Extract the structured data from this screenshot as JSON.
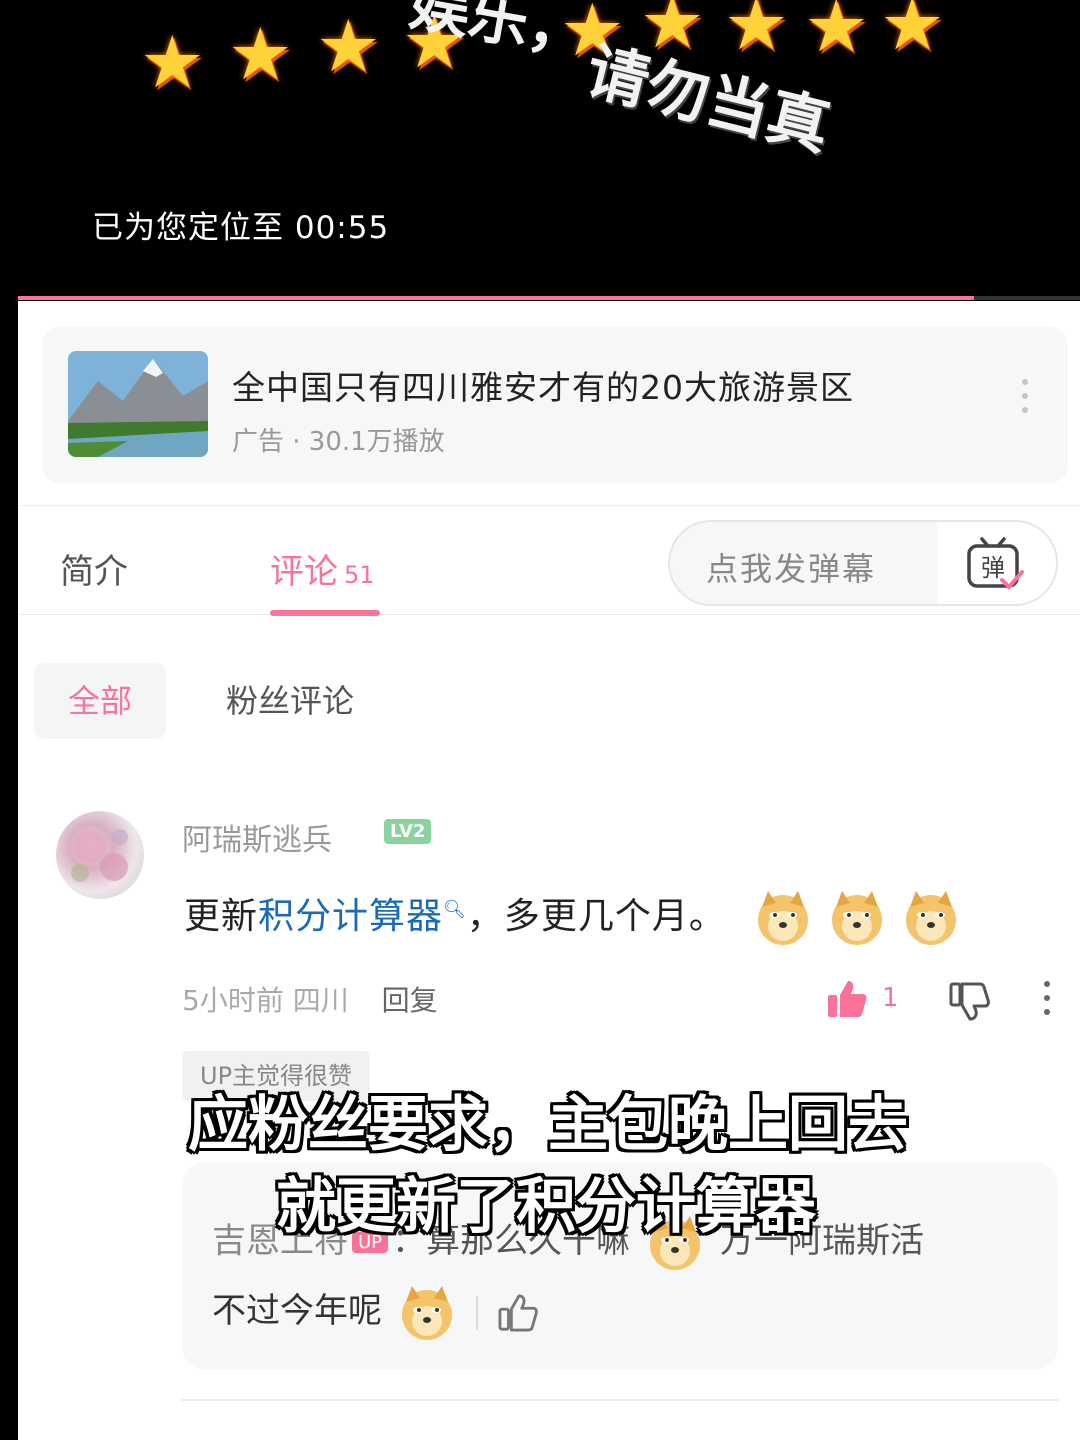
{
  "video": {
    "caption_top": "娱乐，",
    "caption": "请勿当真",
    "seek_message": "已为您定位至 00:55",
    "progress_fraction": 0.9,
    "star_icon": "star-icon"
  },
  "ad": {
    "title": "全中国只有四川雅安才有的20大旅游景区",
    "meta": "广告 · 30.1万播放"
  },
  "tabs": {
    "intro": "简介",
    "comments": "评论",
    "comments_count": "51",
    "danmaku_placeholder": "点我发弹幕",
    "danmaku_icon_char": "弹"
  },
  "filters": {
    "all": "全部",
    "fans": "粉丝评论"
  },
  "comment": {
    "username": "阿瑞斯逃兵",
    "level": "LV2",
    "text_prefix": "更新",
    "text_link": "积分计算器",
    "text_suffix": "，多更几个月。",
    "time": "5小时前",
    "location": "四川",
    "reply_label": "回复",
    "like_count": "1",
    "up_liked": "UP主觉得很赞"
  },
  "reply": {
    "name": "吉恩上将",
    "up_badge": "UP",
    "line1_text": "：算那么久干嘛",
    "line1_tail": "万一阿瑞斯活",
    "line2_text": "不过今年呢"
  },
  "subtitles": {
    "line1": "应粉丝要求，主包晚上回去",
    "line2": "就更新了积分计算器"
  },
  "colors": {
    "accent": "#fb7299",
    "link": "#1a6ab5",
    "level_badge": "#8bd29c"
  }
}
